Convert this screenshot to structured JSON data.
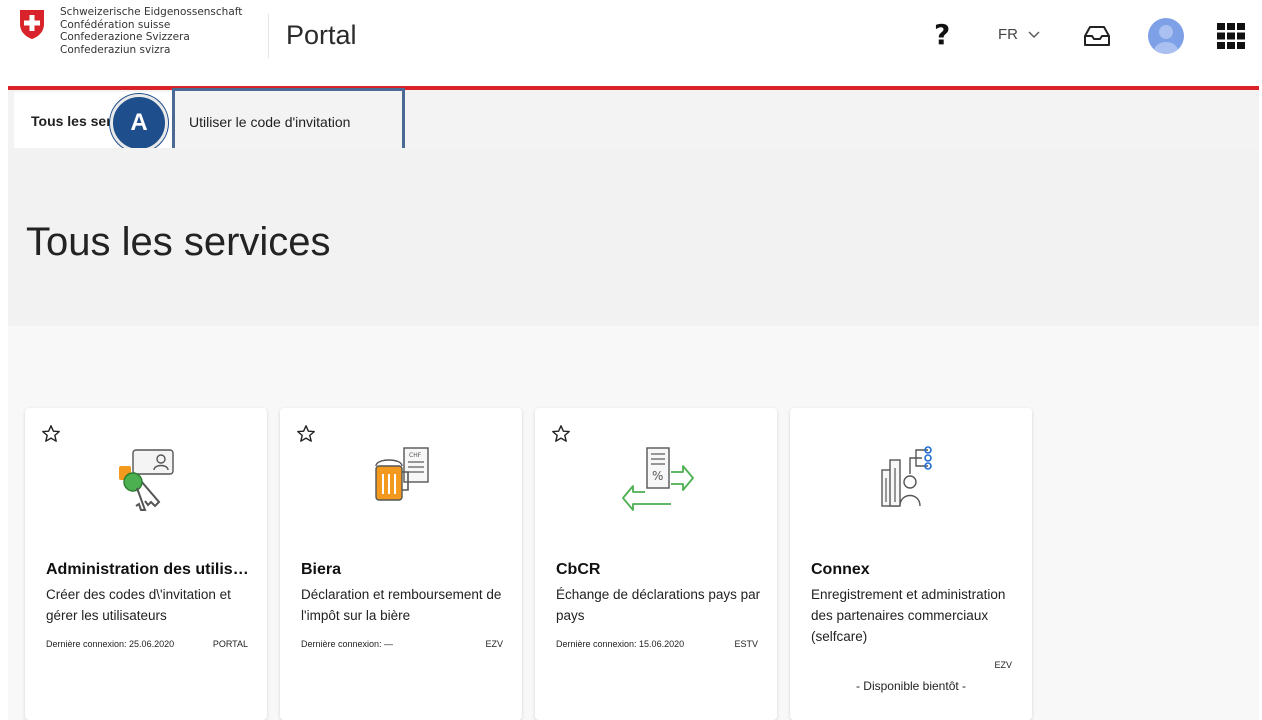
{
  "header": {
    "confederation_names": [
      "Schweizerische Eidgenossenschaft",
      "Confédération suisse",
      "Confederazione Svizzera",
      "Confederaziun svizra"
    ],
    "portal_title": "Portal",
    "help_label": "?",
    "language": "FR"
  },
  "tabs": {
    "all_services": "Tous les services",
    "invitation": "Utiliser le code d'invitation",
    "marker": "A"
  },
  "page_title": "Tous les services",
  "cards": [
    {
      "title": "Administration des utilisateurs",
      "description": "Créer des codes d\\'invitation et gérer les utilisateurs",
      "last_login": "Dernière connexion: 25.06.2020",
      "org": "PORTAL"
    },
    {
      "title": "Biera",
      "description": "Déclaration et remboursement de l'impôt sur la bière",
      "last_login": "Dernière connexion: —",
      "org": "EZV"
    },
    {
      "title": "CbCR",
      "description": "Échange de déclarations pays par pays",
      "last_login": "Dernière connexion: 15.06.2020",
      "org": "ESTV"
    },
    {
      "title": "Connex",
      "description": "Enregistrement et administration des partenaires commerciaux (selfcare)",
      "org": "EZV",
      "status": "- Disponible bientôt -"
    }
  ],
  "colors": {
    "accent_red": "#d8232a",
    "highlight_blue": "#4a6a94",
    "marker_blue": "#1f4e8c",
    "icon_green": "#4caf50",
    "icon_orange": "#f39a1e"
  }
}
